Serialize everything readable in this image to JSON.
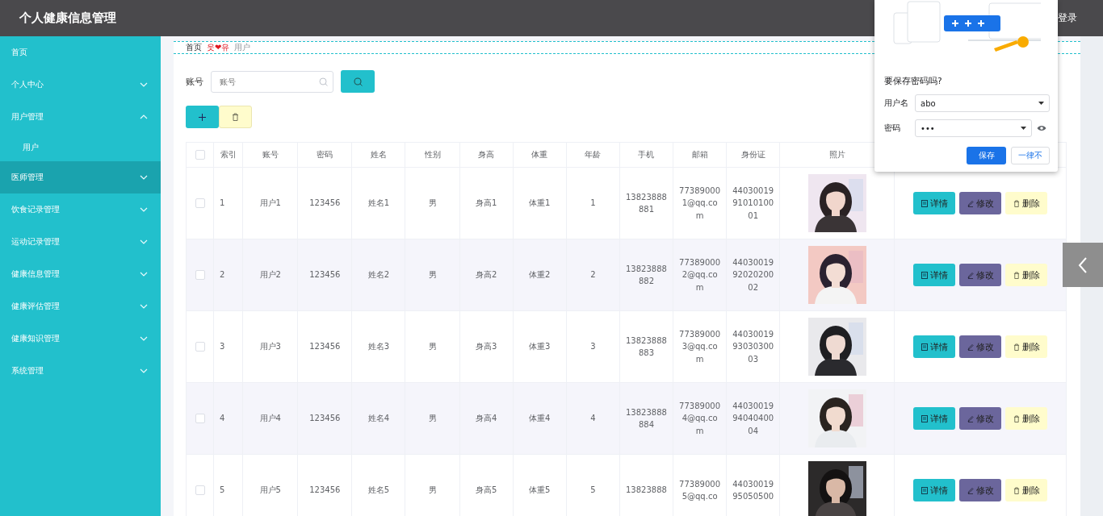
{
  "header": {
    "title": "个人健康信息管理",
    "login": "登录"
  },
  "sidebar": {
    "items": [
      {
        "label": "首页",
        "kind": "plain",
        "selected": false
      },
      {
        "label": "个人中心",
        "kind": "group",
        "expanded": false,
        "selected": false
      },
      {
        "label": "用户管理",
        "kind": "group",
        "expanded": true,
        "selected": false,
        "children": [
          {
            "label": "用户",
            "selected": false
          }
        ]
      },
      {
        "label": "医师管理",
        "kind": "group",
        "expanded": false,
        "selected": true
      },
      {
        "label": "饮食记录管理",
        "kind": "group",
        "expanded": false,
        "selected": false
      },
      {
        "label": "运动记录管理",
        "kind": "group",
        "expanded": false,
        "selected": false
      },
      {
        "label": "健康信息管理",
        "kind": "group",
        "expanded": false,
        "selected": false
      },
      {
        "label": "健康评估管理",
        "kind": "group",
        "expanded": false,
        "selected": false
      },
      {
        "label": "健康知识管理",
        "kind": "group",
        "expanded": false,
        "selected": false
      },
      {
        "label": "系统管理",
        "kind": "group",
        "expanded": false,
        "selected": false
      }
    ]
  },
  "breadcrumb": {
    "home": "首页",
    "separator": "웃❤유",
    "current": "用户"
  },
  "search": {
    "label": "账号",
    "placeholder": "账号"
  },
  "table": {
    "header_checked": false,
    "columns": [
      "索引",
      "账号",
      "密码",
      "姓名",
      "性别",
      "身高",
      "体重",
      "年龄",
      "手机",
      "邮箱",
      "身份证",
      "照片"
    ],
    "rows": [
      {
        "checked": false,
        "cells": [
          [
            "1"
          ],
          [
            "用户1"
          ],
          [
            "123456"
          ],
          [
            "姓名1"
          ],
          [
            "男"
          ],
          [
            "身高1"
          ],
          [
            "体重1"
          ],
          [
            "1"
          ],
          [
            "13823888",
            "881"
          ],
          [
            "77389000",
            "1@qq.co",
            "m"
          ],
          [
            "44030019",
            "91010100",
            "01"
          ]
        ],
        "actions": [
          "详情",
          "修改",
          "删除"
        ]
      },
      {
        "checked": false,
        "cells": [
          [
            "2"
          ],
          [
            "用户2"
          ],
          [
            "123456"
          ],
          [
            "姓名2"
          ],
          [
            "男"
          ],
          [
            "身高2"
          ],
          [
            "体重2"
          ],
          [
            "2"
          ],
          [
            "13823888",
            "882"
          ],
          [
            "77389000",
            "2@qq.co",
            "m"
          ],
          [
            "44030019",
            "92020200",
            "02"
          ]
        ],
        "actions": [
          "详情",
          "修改",
          "删除"
        ]
      },
      {
        "checked": false,
        "cells": [
          [
            "3"
          ],
          [
            "用户3"
          ],
          [
            "123456"
          ],
          [
            "姓名3"
          ],
          [
            "男"
          ],
          [
            "身高3"
          ],
          [
            "体重3"
          ],
          [
            "3"
          ],
          [
            "13823888",
            "883"
          ],
          [
            "77389000",
            "3@qq.co",
            "m"
          ],
          [
            "44030019",
            "93030300",
            "03"
          ]
        ],
        "actions": [
          "详情",
          "修改",
          "删除"
        ]
      },
      {
        "checked": false,
        "cells": [
          [
            "4"
          ],
          [
            "用户4"
          ],
          [
            "123456"
          ],
          [
            "姓名4"
          ],
          [
            "男"
          ],
          [
            "身高4"
          ],
          [
            "体重4"
          ],
          [
            "4"
          ],
          [
            "13823888",
            "884"
          ],
          [
            "77389000",
            "4@qq.co",
            "m"
          ],
          [
            "44030019",
            "94040400",
            "04"
          ]
        ],
        "actions": [
          "详情",
          "修改",
          "删除"
        ]
      },
      {
        "checked": false,
        "cells": [
          [
            "5"
          ],
          [
            "用户5"
          ],
          [
            "123456"
          ],
          [
            "姓名5"
          ],
          [
            "男"
          ],
          [
            "身高5"
          ],
          [
            "体重5"
          ],
          [
            "5"
          ],
          [
            "13823888"
          ],
          [
            "77389000",
            "5@qq.co"
          ],
          [
            "44030019",
            "95050500"
          ]
        ],
        "actions": [
          "详情",
          "修改",
          "删除"
        ]
      }
    ]
  },
  "password_popup": {
    "question": "要保存密码吗?",
    "username_label": "用户名",
    "username": "abo",
    "password_label": "密码",
    "password": "•••",
    "save": "保存",
    "never": "一律不"
  }
}
